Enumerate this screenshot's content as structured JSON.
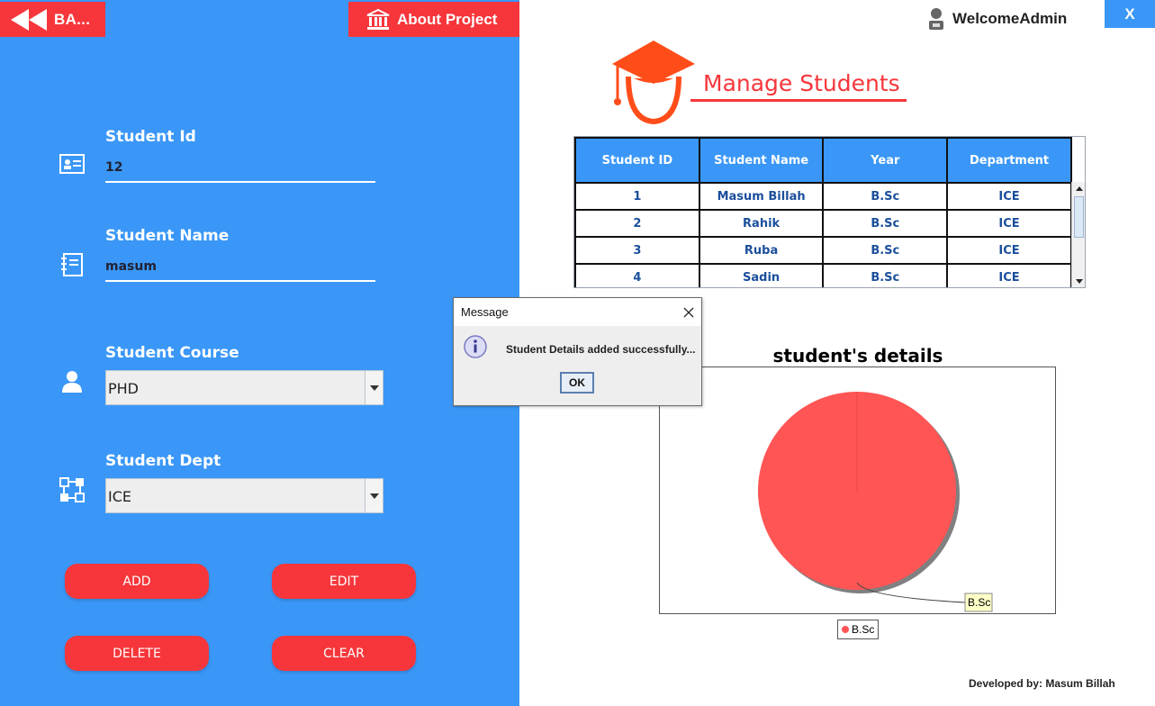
{
  "header": {
    "back_label": "BA...",
    "about_label": "About Project",
    "welcome_label": "WelcomeAdmin",
    "close_label": "X"
  },
  "form": {
    "student_id_label": "Student Id",
    "student_id_value": "12",
    "student_name_label": "Student Name",
    "student_name_value": "masum",
    "course_label": "Student Course",
    "course_value": "PHD",
    "dept_label": "Student Dept",
    "dept_value": "ICE"
  },
  "buttons": {
    "add": "ADD",
    "edit": "EDIT",
    "delete": "DELETE",
    "clear": "CLEAR"
  },
  "page": {
    "title": "Manage Students"
  },
  "table": {
    "columns": [
      "Student ID",
      "Student Name",
      "Year",
      "Department"
    ],
    "rows": [
      [
        "1",
        "Masum Billah",
        "B.Sc",
        "ICE"
      ],
      [
        "2",
        "Rahik",
        "B.Sc",
        "ICE"
      ],
      [
        "3",
        "Ruba",
        "B.Sc",
        "ICE"
      ],
      [
        "4",
        "Sadin",
        "B.Sc",
        "ICE"
      ]
    ]
  },
  "chart_data": {
    "type": "pie",
    "title": "student's details",
    "categories": [
      "B.Sc"
    ],
    "values": [
      100
    ],
    "colors": [
      "#ff5555"
    ],
    "legend": [
      "B.Sc"
    ],
    "legend_position": "bottom"
  },
  "dialog": {
    "title": "Message",
    "message": "Student Details added successfully...",
    "ok_label": "OK"
  },
  "footer": {
    "credit": "Developed by: Masum Billah"
  },
  "colors": {
    "panel_blue": "#3a97f7",
    "accent_red": "#f6363b"
  }
}
